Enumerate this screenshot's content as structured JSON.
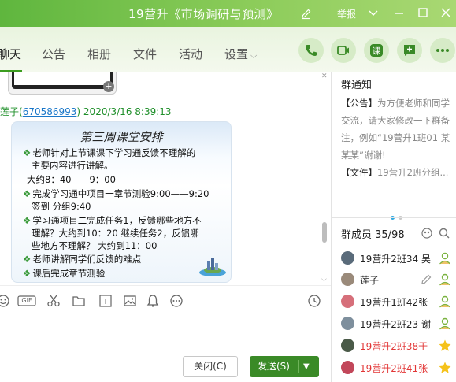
{
  "window": {
    "title": "19营升《市场调研与预测》",
    "report_label": "举报",
    "colors": {
      "accent": "#3a8a27",
      "titlebar": "#7cc24d"
    }
  },
  "tabs": [
    {
      "label": "聊天",
      "active": true
    },
    {
      "label": "公告",
      "active": false
    },
    {
      "label": "相册",
      "active": false
    },
    {
      "label": "文件",
      "active": false
    },
    {
      "label": "活动",
      "active": false
    },
    {
      "label": "设置",
      "active": false
    }
  ],
  "header_actions": [
    "phone-icon",
    "video-icon",
    "course-icon",
    "message-add-icon",
    "more-icon"
  ],
  "chat": {
    "sender_name": "莲子",
    "sender_id": "670586993",
    "timestamp": "2020/3/16 8:39:13",
    "slide": {
      "title": "第三周课堂安排",
      "lines": [
        {
          "text": "老师针对上节课课下学习通反馈不理解的",
          "bullet": true
        },
        {
          "text": "主要内容进行讲解。",
          "bullet": false
        },
        {
          "text": "大约8：40——9：00",
          "bullet": false
        },
        {
          "text": "完成学习通中项目一章节测验9:00——9:20",
          "bullet": true
        },
        {
          "text": "签到  分组9:40",
          "bullet": false
        },
        {
          "text": "学习通项目二完成任务1，反馈哪些地方不",
          "bullet": true
        },
        {
          "text": "理解？大约到10：20  继续任务2，反馈哪",
          "bullet": false
        },
        {
          "text": "些地方不理解？ 大约到11：00",
          "bullet": false
        },
        {
          "text": "老师讲解同学们反馈的难点",
          "bullet": true
        },
        {
          "text": "课后完成章节测验",
          "bullet": true
        }
      ]
    }
  },
  "toolbar": {
    "tools": [
      "emoji-icon",
      "gif-icon",
      "scissors-icon",
      "folder-icon",
      "text-format-icon",
      "image-icon",
      "bell-icon",
      "more-circle-icon",
      "history-icon"
    ],
    "gif_label": "GIF"
  },
  "buttons": {
    "close_label": "关闭(C)",
    "send_label": "发送(S)"
  },
  "notice": {
    "title": "群通知",
    "announcement_tag": "【公告】",
    "announcement_text": "为方便老师和同学交流，请大家修改一下群备注，例如“19营升1班01 某某某”谢谢!",
    "file_tag": "【文件】",
    "file_text": "19营升2班分组..."
  },
  "members": {
    "header": "群成员 35/98",
    "list": [
      {
        "name": "19营升2班34 吴",
        "red": false,
        "role": "member-icon"
      },
      {
        "name": "莲子",
        "red": false,
        "role": "edit-icon"
      },
      {
        "name": "19营升1班42张",
        "red": false,
        "role": "member-icon"
      },
      {
        "name": "19营升2班23  谢",
        "red": false,
        "role": "member-icon"
      },
      {
        "name": "19营升2班38于",
        "red": true,
        "role": "star-icon"
      },
      {
        "name": "19营升2班41张",
        "red": true,
        "role": "star-icon"
      }
    ]
  }
}
